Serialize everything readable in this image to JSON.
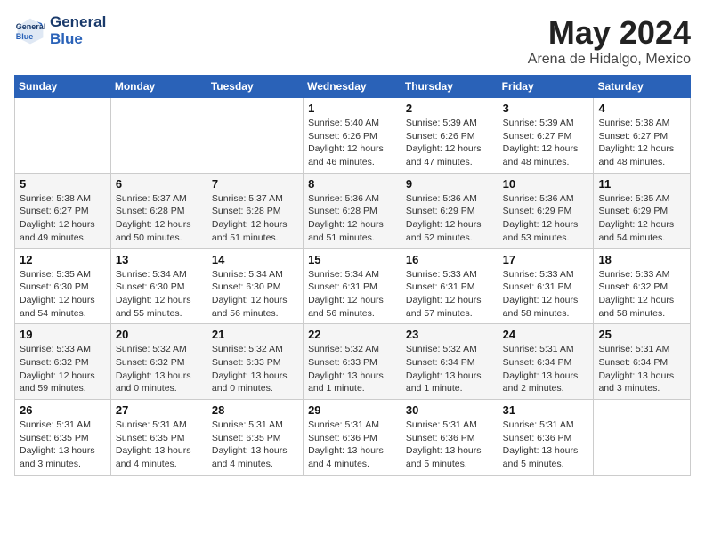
{
  "header": {
    "logo_line1": "General",
    "logo_line2": "Blue",
    "title": "May 2024",
    "subtitle": "Arena de Hidalgo, Mexico"
  },
  "weekdays": [
    "Sunday",
    "Monday",
    "Tuesday",
    "Wednesday",
    "Thursday",
    "Friday",
    "Saturday"
  ],
  "weeks": [
    [
      {
        "day": "",
        "info": ""
      },
      {
        "day": "",
        "info": ""
      },
      {
        "day": "",
        "info": ""
      },
      {
        "day": "1",
        "info": "Sunrise: 5:40 AM\nSunset: 6:26 PM\nDaylight: 12 hours\nand 46 minutes."
      },
      {
        "day": "2",
        "info": "Sunrise: 5:39 AM\nSunset: 6:26 PM\nDaylight: 12 hours\nand 47 minutes."
      },
      {
        "day": "3",
        "info": "Sunrise: 5:39 AM\nSunset: 6:27 PM\nDaylight: 12 hours\nand 48 minutes."
      },
      {
        "day": "4",
        "info": "Sunrise: 5:38 AM\nSunset: 6:27 PM\nDaylight: 12 hours\nand 48 minutes."
      }
    ],
    [
      {
        "day": "5",
        "info": "Sunrise: 5:38 AM\nSunset: 6:27 PM\nDaylight: 12 hours\nand 49 minutes."
      },
      {
        "day": "6",
        "info": "Sunrise: 5:37 AM\nSunset: 6:28 PM\nDaylight: 12 hours\nand 50 minutes."
      },
      {
        "day": "7",
        "info": "Sunrise: 5:37 AM\nSunset: 6:28 PM\nDaylight: 12 hours\nand 51 minutes."
      },
      {
        "day": "8",
        "info": "Sunrise: 5:36 AM\nSunset: 6:28 PM\nDaylight: 12 hours\nand 51 minutes."
      },
      {
        "day": "9",
        "info": "Sunrise: 5:36 AM\nSunset: 6:29 PM\nDaylight: 12 hours\nand 52 minutes."
      },
      {
        "day": "10",
        "info": "Sunrise: 5:36 AM\nSunset: 6:29 PM\nDaylight: 12 hours\nand 53 minutes."
      },
      {
        "day": "11",
        "info": "Sunrise: 5:35 AM\nSunset: 6:29 PM\nDaylight: 12 hours\nand 54 minutes."
      }
    ],
    [
      {
        "day": "12",
        "info": "Sunrise: 5:35 AM\nSunset: 6:30 PM\nDaylight: 12 hours\nand 54 minutes."
      },
      {
        "day": "13",
        "info": "Sunrise: 5:34 AM\nSunset: 6:30 PM\nDaylight: 12 hours\nand 55 minutes."
      },
      {
        "day": "14",
        "info": "Sunrise: 5:34 AM\nSunset: 6:30 PM\nDaylight: 12 hours\nand 56 minutes."
      },
      {
        "day": "15",
        "info": "Sunrise: 5:34 AM\nSunset: 6:31 PM\nDaylight: 12 hours\nand 56 minutes."
      },
      {
        "day": "16",
        "info": "Sunrise: 5:33 AM\nSunset: 6:31 PM\nDaylight: 12 hours\nand 57 minutes."
      },
      {
        "day": "17",
        "info": "Sunrise: 5:33 AM\nSunset: 6:31 PM\nDaylight: 12 hours\nand 58 minutes."
      },
      {
        "day": "18",
        "info": "Sunrise: 5:33 AM\nSunset: 6:32 PM\nDaylight: 12 hours\nand 58 minutes."
      }
    ],
    [
      {
        "day": "19",
        "info": "Sunrise: 5:33 AM\nSunset: 6:32 PM\nDaylight: 12 hours\nand 59 minutes."
      },
      {
        "day": "20",
        "info": "Sunrise: 5:32 AM\nSunset: 6:32 PM\nDaylight: 13 hours\nand 0 minutes."
      },
      {
        "day": "21",
        "info": "Sunrise: 5:32 AM\nSunset: 6:33 PM\nDaylight: 13 hours\nand 0 minutes."
      },
      {
        "day": "22",
        "info": "Sunrise: 5:32 AM\nSunset: 6:33 PM\nDaylight: 13 hours\nand 1 minute."
      },
      {
        "day": "23",
        "info": "Sunrise: 5:32 AM\nSunset: 6:34 PM\nDaylight: 13 hours\nand 1 minute."
      },
      {
        "day": "24",
        "info": "Sunrise: 5:31 AM\nSunset: 6:34 PM\nDaylight: 13 hours\nand 2 minutes."
      },
      {
        "day": "25",
        "info": "Sunrise: 5:31 AM\nSunset: 6:34 PM\nDaylight: 13 hours\nand 3 minutes."
      }
    ],
    [
      {
        "day": "26",
        "info": "Sunrise: 5:31 AM\nSunset: 6:35 PM\nDaylight: 13 hours\nand 3 minutes."
      },
      {
        "day": "27",
        "info": "Sunrise: 5:31 AM\nSunset: 6:35 PM\nDaylight: 13 hours\nand 4 minutes."
      },
      {
        "day": "28",
        "info": "Sunrise: 5:31 AM\nSunset: 6:35 PM\nDaylight: 13 hours\nand 4 minutes."
      },
      {
        "day": "29",
        "info": "Sunrise: 5:31 AM\nSunset: 6:36 PM\nDaylight: 13 hours\nand 4 minutes."
      },
      {
        "day": "30",
        "info": "Sunrise: 5:31 AM\nSunset: 6:36 PM\nDaylight: 13 hours\nand 5 minutes."
      },
      {
        "day": "31",
        "info": "Sunrise: 5:31 AM\nSunset: 6:36 PM\nDaylight: 13 hours\nand 5 minutes."
      },
      {
        "day": "",
        "info": ""
      }
    ]
  ]
}
